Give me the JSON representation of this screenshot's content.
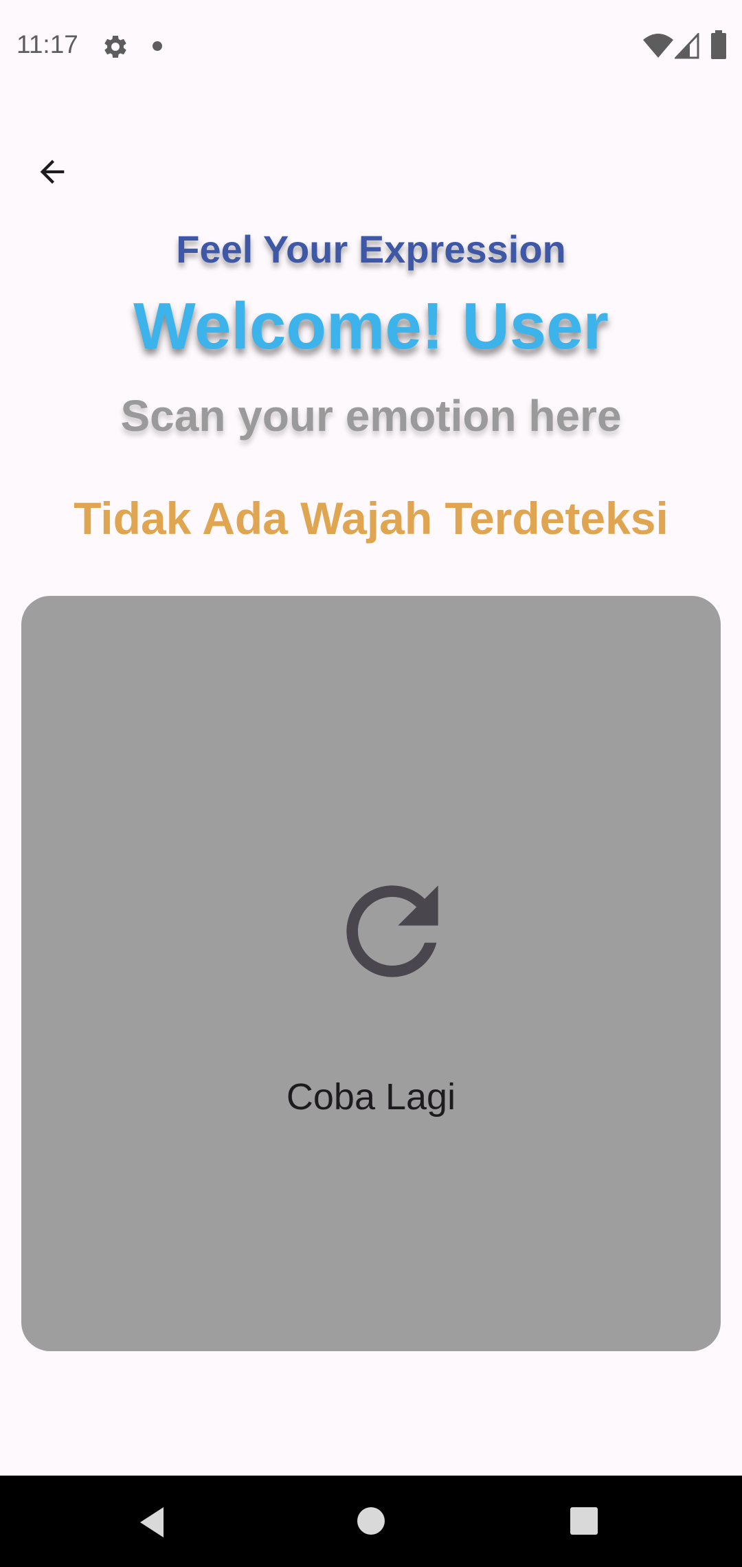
{
  "status_bar": {
    "time": "11:17",
    "icons": [
      "gear-icon",
      "notification-dot-icon",
      "wifi-icon",
      "signal-icon",
      "battery-icon"
    ]
  },
  "header": {
    "back_icon": "arrow-back-icon",
    "tagline": "Feel Your Expression",
    "welcome": "Welcome! User",
    "subtitle": "Scan your emotion here"
  },
  "detection": {
    "message": "Tidak Ada Wajah Terdeteksi"
  },
  "camera_card": {
    "retry_icon": "refresh-icon",
    "retry_label": "Coba Lagi"
  },
  "nav_bar": {
    "icons": [
      "nav-back-icon",
      "nav-home-icon",
      "nav-recents-icon"
    ]
  },
  "colors": {
    "tagline": "#3f58a6",
    "welcome": "#3cb3ea",
    "subtitle": "#9a9a9a",
    "message": "#dfa550",
    "card": "#9e9e9e",
    "icon_dark": "#49464d"
  }
}
